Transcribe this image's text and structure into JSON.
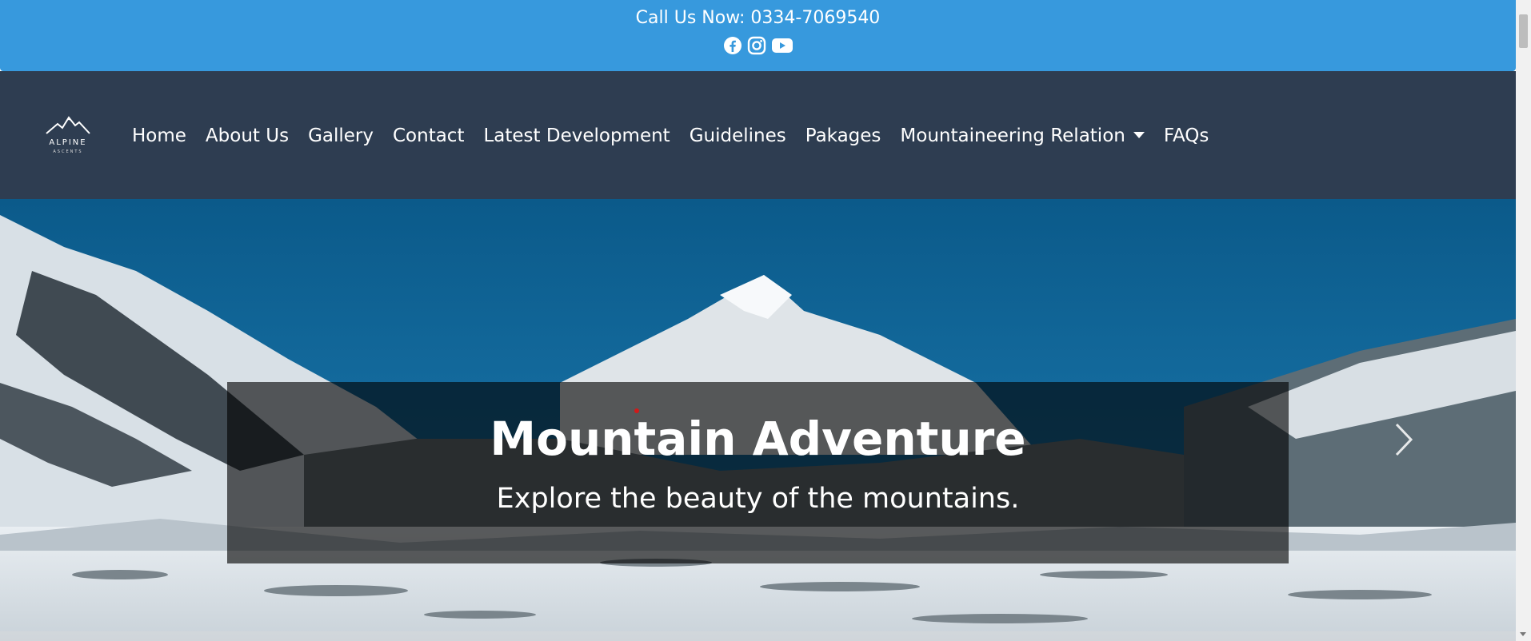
{
  "topbar": {
    "call_text": "Call Us Now: 0334-7069540",
    "social_icons": [
      "facebook-icon",
      "instagram-icon",
      "youtube-icon"
    ],
    "background": "#3799dd"
  },
  "navbar": {
    "logo_text": "ALPINE",
    "logo_subtext": "ASCENTS",
    "items": [
      {
        "label": "Home"
      },
      {
        "label": "About Us"
      },
      {
        "label": "Gallery"
      },
      {
        "label": "Contact"
      },
      {
        "label": "Latest Development"
      },
      {
        "label": "Guidelines"
      },
      {
        "label": "Pakages"
      },
      {
        "label": "Mountaineering Relation",
        "dropdown": true
      },
      {
        "label": "FAQs"
      }
    ],
    "background": "#2e3d51"
  },
  "hero": {
    "title": "Mountain Adventure",
    "subtitle": "Explore the beauty of the mountains.",
    "next_icon": "chevron-right-icon"
  }
}
